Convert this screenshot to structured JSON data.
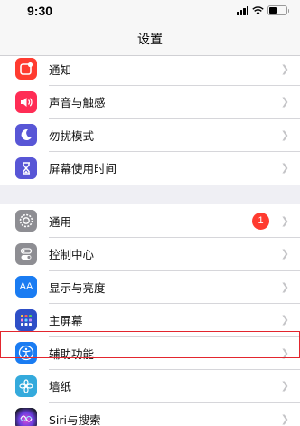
{
  "status": {
    "time": "9:30"
  },
  "nav": {
    "title": "设置"
  },
  "group1": [
    {
      "label": "通知",
      "icon": "notifications-icon",
      "color": "#ff3b30"
    },
    {
      "label": "声音与触感",
      "icon": "speaker-icon",
      "color": "#ff2d55"
    },
    {
      "label": "勿扰模式",
      "icon": "moon-icon",
      "color": "#5856d6"
    },
    {
      "label": "屏幕使用时间",
      "icon": "hourglass-icon",
      "color": "#5856d6"
    }
  ],
  "group2": [
    {
      "label": "通用",
      "icon": "gear-icon",
      "color": "#8e8e93",
      "badge": "1"
    },
    {
      "label": "控制中心",
      "icon": "toggles-icon",
      "color": "#8e8e93"
    },
    {
      "label": "显示与亮度",
      "icon": "aa-icon",
      "color": "#1a7cf2",
      "icon_text": "AA"
    },
    {
      "label": "主屏幕",
      "icon": "home-screen-icon",
      "color": "#2e4fc7"
    },
    {
      "label": "辅助功能",
      "icon": "accessibility-icon",
      "color": "#1a7cf2"
    },
    {
      "label": "墙纸",
      "icon": "wallpaper-icon",
      "color": "#34aadc"
    },
    {
      "label": "Siri与搜索",
      "icon": "siri-icon",
      "color": "#222"
    }
  ],
  "colors": {
    "highlight": "#e3262e",
    "badge": "#ff3b30"
  }
}
